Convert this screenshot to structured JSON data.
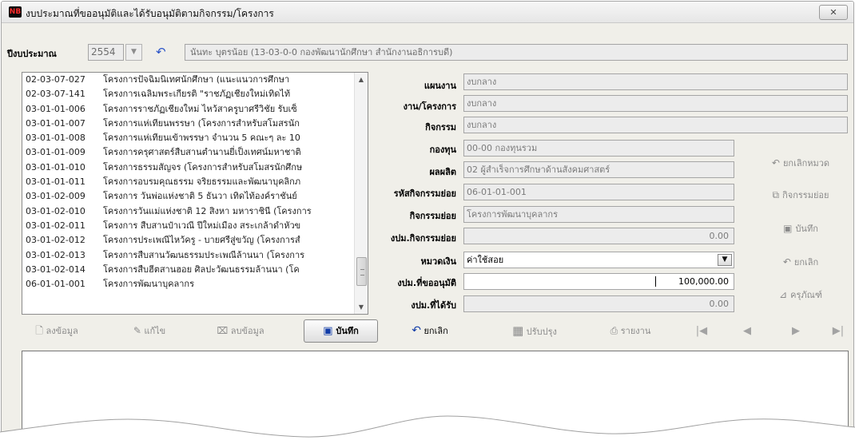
{
  "window": {
    "title": "งบประมาณที่ขออนุมัติและได้รับอนุมัติตามกิจกรรม/โครงการ",
    "icon_text": "NB",
    "close_label": "✕"
  },
  "header": {
    "year_label": "ปีงบประมาณ",
    "year_value": "2554",
    "department_value": "นันทะ บุตรน้อย  (13-03-0-0 กองพัฒนานักศึกษา สำนักงานอธิการบดี)"
  },
  "project_list": [
    {
      "code": "02-03-07-027",
      "name": "โครงการปัจฉิมนิเทศนักศึกษา (แนะแนวการศึกษา"
    },
    {
      "code": "02-03-07-141",
      "name": "โครงการเฉลิมพระเกียรติ \"ราชภัฏเชียงใหม่เทิดไท้"
    },
    {
      "code": "03-01-01-006",
      "name": "โครงการราชภัฏเชียงใหม่ ไหว้สาครูบาศรีวิชัย รับเซ็"
    },
    {
      "code": "03-01-01-007",
      "name": "โครงการแห่เทียนพรรษา (โครงการสำหรับสโมสรนัก"
    },
    {
      "code": "03-01-01-008",
      "name": "โครงการแห่เทียนเข้าพรรษา จำนวน 5 คณะๆ ละ 10"
    },
    {
      "code": "03-01-01-009",
      "name": "โครงการครุศาสตร์สืบสานตำนานยี่เป็งเทศน์มหาชาติ"
    },
    {
      "code": "03-01-01-010",
      "name": "โครงการธรรมสัญจร (โครงการสำหรับสโมสรนักศึกษ"
    },
    {
      "code": "03-01-01-011",
      "name": "โครงการอบรมคุณธรรม จริยธรรมและพัฒนาบุคลิกภ"
    },
    {
      "code": "03-01-02-009",
      "name": "โครงการ วันพ่อแห่งชาติ 5 ธันวา เทิดไท้องค์ราชันย์"
    },
    {
      "code": "03-01-02-010",
      "name": "โครงการวันแม่แห่งชาติ 12 สิงหา มหาราชินี (โครงการ"
    },
    {
      "code": "03-01-02-011",
      "name": "โครงการ สืบสานป๋าเวณี ปีใหม่เมือง สระเกล้าดำหัวข"
    },
    {
      "code": "03-01-02-012",
      "name": "โครงการประเพณีไหว้ครู - บายศรีสู่ขวัญ (โครงการสํ"
    },
    {
      "code": "03-01-02-013",
      "name": "โครงการสืบสานวัฒนธรรมประเพณีล้านนา (โครงการ"
    },
    {
      "code": "03-01-02-014",
      "name": "โครงการสืบฮีตสานฮอย ศิลปะวัฒนธรรมล้านนา (โค"
    },
    {
      "code": "06-01-01-001",
      "name": "โครงการพัฒนาบุคลากร"
    }
  ],
  "form": {
    "plan_label": "แผนงาน",
    "plan_value": "งบกลาง",
    "project_label": "งาน/โครงการ",
    "project_value": "งบกลาง",
    "activity_label": "กิจกรรม",
    "activity_value": "งบกลาง",
    "fund_label": "กองทุน",
    "fund_value": "00-00 กองทุนรวม",
    "output_label": "ผลผลิต",
    "output_value": "02 ผู้สำเร็จการศึกษาด้านสังคมศาสตร์",
    "subactivity_code_label": "รหัสกิจกรรมย่อย",
    "subactivity_code_value": "06-01-01-001",
    "subactivity_label": "กิจกรรมย่อย",
    "subactivity_value": "โครงการพัฒนาบุคลากร",
    "sub_budget_label": "งปม.กิจกรรมย่อย",
    "sub_budget_value": "0.00",
    "category_label": "หมวดเงิน",
    "category_value": "ค่าใช้สอย",
    "requested_label": "งปม.ที่ขออนุมัติ",
    "requested_value": "100,000.00",
    "received_label": "งปม.ที่ได้รับ",
    "received_value": "0.00"
  },
  "side_buttons": {
    "cancel_category": "ยกเลิกหมวด",
    "subactivity": "กิจกรรมย่อย",
    "save": "บันทึก",
    "cancel": "ยกเลิก",
    "durable": "ครุภัณฑ์"
  },
  "toolbar": {
    "add": "ลงข้อมูล",
    "edit": "แก้ไข",
    "delete": "ลบข้อมูล",
    "save": "บันทึก",
    "cancel": "ยกเลิก",
    "update": "ปรับปรุง",
    "report": "รายงาน"
  }
}
